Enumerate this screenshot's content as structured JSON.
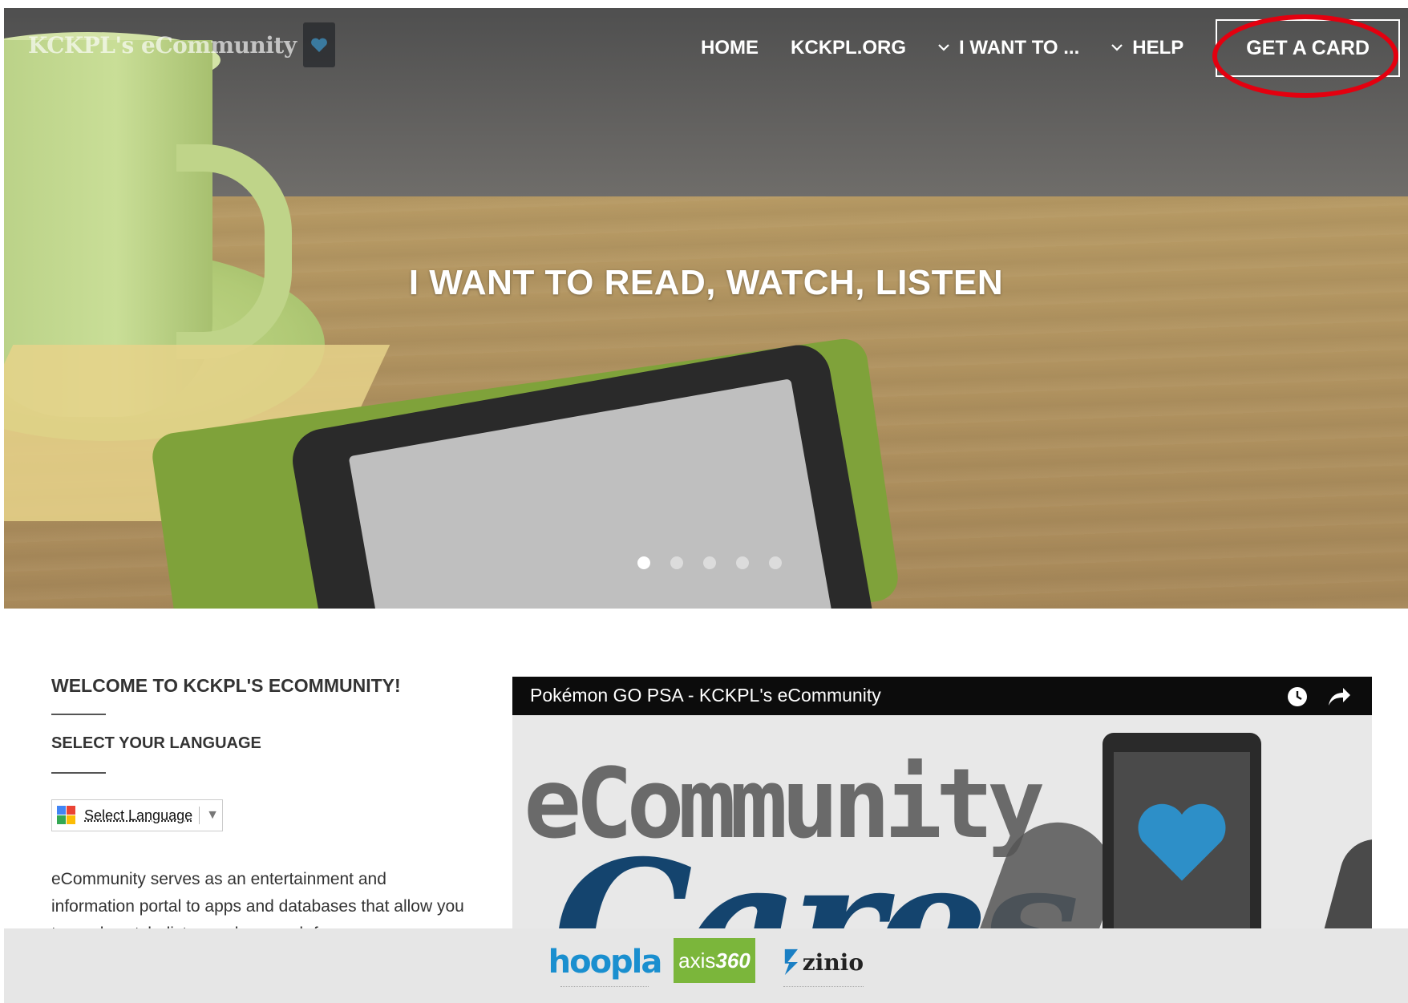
{
  "brand": {
    "logo_text": "KCKPL's eCommunity",
    "logo_icon": "heart-icon"
  },
  "nav": {
    "home": "HOME",
    "kckpl_org": "KCKPL.ORG",
    "i_want_to": "I WANT TO ...",
    "help": "HELP",
    "get_a_card": "GET A CARD",
    "dropdown_icon": "chevron-down-icon"
  },
  "hero": {
    "title": "I WANT TO READ, WATCH, LISTEN",
    "slides_total": 5,
    "active_slide": 1
  },
  "welcome": {
    "heading": "WELCOME TO KCKPL'S ECOMMUNITY!",
    "language_heading": "SELECT YOUR LANGUAGE",
    "language_select_label": "Select Language",
    "description": "eCommunity serves as an entertainment and information portal to apps and databases that allow you to read, watch, listen and research from any"
  },
  "video": {
    "title": "Pokémon GO PSA - KCKPL's eCommunity",
    "thumb_text_top": "eCommunity",
    "thumb_text_script": "Cares"
  },
  "partners": {
    "hoopla": "hoopla",
    "axis_prefix": "axis",
    "axis_number": "360",
    "zinio": "zinio"
  },
  "colors": {
    "annotation": "#e3000f",
    "heart": "#2d8fc8",
    "axis_green": "#7bb63b"
  }
}
